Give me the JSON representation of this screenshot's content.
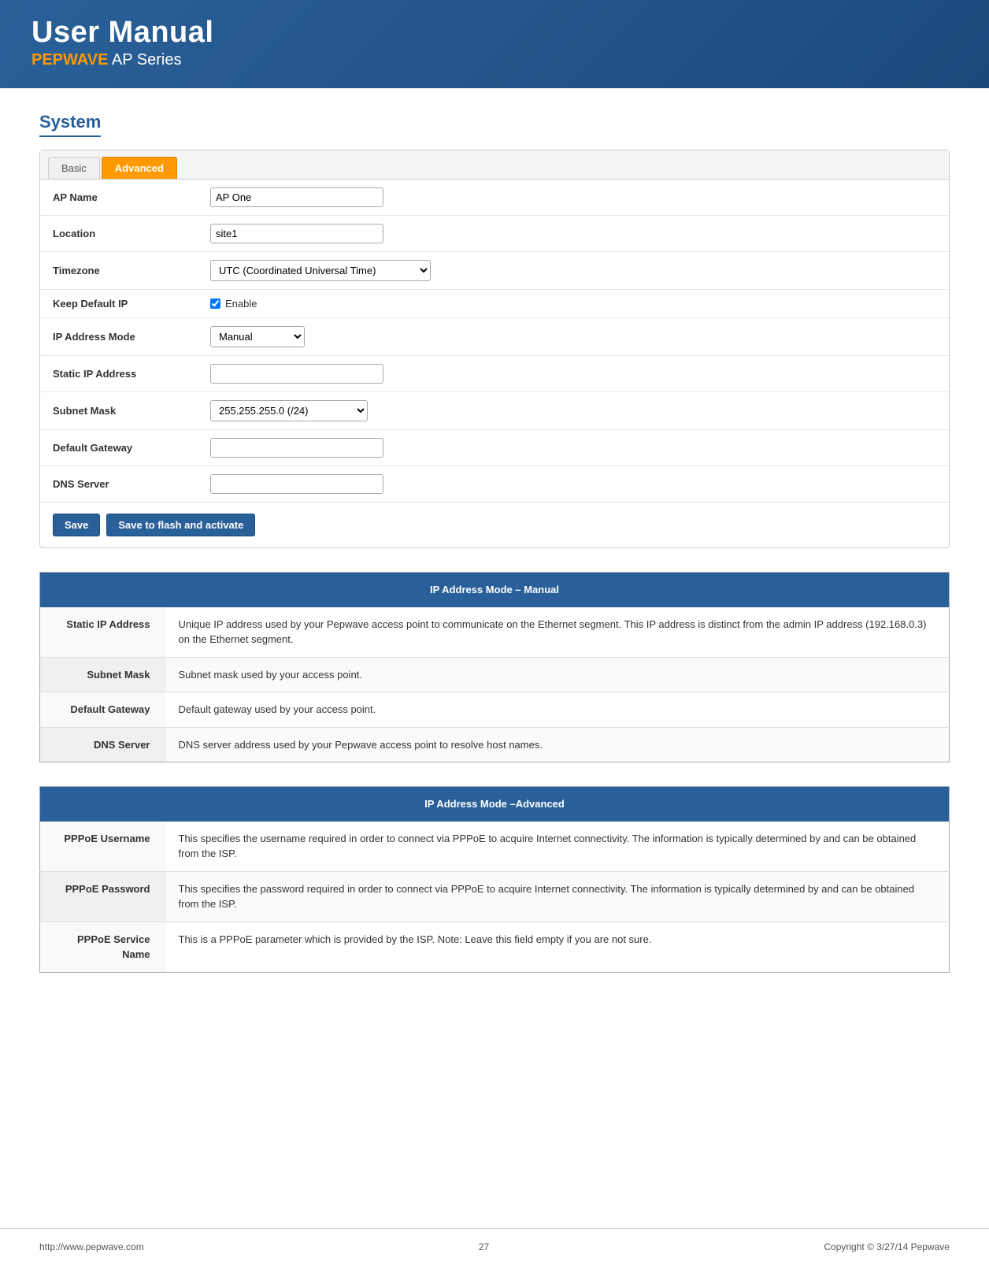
{
  "header": {
    "title": "User Manual",
    "subtitle_brand": "PEPWAVE",
    "subtitle_rest": " AP Series"
  },
  "system_section": {
    "title": "System",
    "tabs": [
      {
        "label": "Basic",
        "active": false
      },
      {
        "label": "Advanced",
        "active": true
      }
    ],
    "form_rows": [
      {
        "label": "AP Name",
        "type": "text",
        "value": "AP One",
        "placeholder": ""
      },
      {
        "label": "Location",
        "type": "text",
        "value": "site1",
        "placeholder": ""
      },
      {
        "label": "Timezone",
        "type": "select",
        "value": "UTC (Coordinated Universal Time)",
        "size": "wide"
      },
      {
        "label": "Keep Default IP",
        "type": "checkbox",
        "checked": true,
        "checkbox_label": "Enable"
      },
      {
        "label": "IP Address Mode",
        "type": "select",
        "value": "Manual",
        "size": "medium"
      },
      {
        "label": "Static IP Address",
        "type": "text",
        "value": "",
        "placeholder": ""
      },
      {
        "label": "Subnet Mask",
        "type": "select_subnet",
        "value": "255.255.255.0 (/24)",
        "size": "medium"
      },
      {
        "label": "Default Gateway",
        "type": "text",
        "value": "",
        "placeholder": ""
      },
      {
        "label": "DNS Server",
        "type": "text",
        "value": "",
        "placeholder": ""
      }
    ],
    "buttons": {
      "save": "Save",
      "save_flash": "Save to flash and activate"
    }
  },
  "ip_manual_table": {
    "header": "IP Address Mode – Manual",
    "rows": [
      {
        "label": "Static IP Address",
        "desc": "Unique IP address used by your Pepwave access point to communicate on the Ethernet segment. This IP address is distinct from the admin IP address (192.168.0.3) on the Ethernet segment."
      },
      {
        "label": "Subnet Mask",
        "desc": "Subnet mask used by your access point."
      },
      {
        "label": "Default Gateway",
        "desc": "Default gateway used by your access point."
      },
      {
        "label": "DNS Server",
        "desc": "DNS server address used by your Pepwave access point to resolve host names."
      }
    ]
  },
  "ip_advanced_table": {
    "header": "IP Address Mode –Advanced",
    "rows": [
      {
        "label": "PPPoE Username",
        "desc": "This specifies the username required in order to connect via PPPoE to acquire Internet connectivity. The information is typically determined by and can be obtained from the ISP."
      },
      {
        "label": "PPPoE Password",
        "desc": "This specifies the password required in order to connect via PPPoE to acquire Internet connectivity. The information is typically determined by and can be obtained from the ISP."
      },
      {
        "label": "PPPoE Service Name",
        "desc": "This is a PPPoE parameter which is provided by the ISP. Note: Leave this field empty if you are not sure."
      }
    ]
  },
  "footer": {
    "url": "http://www.pepwave.com",
    "page_number": "27",
    "copyright": "Copyright © 3/27/14 Pepwave"
  }
}
